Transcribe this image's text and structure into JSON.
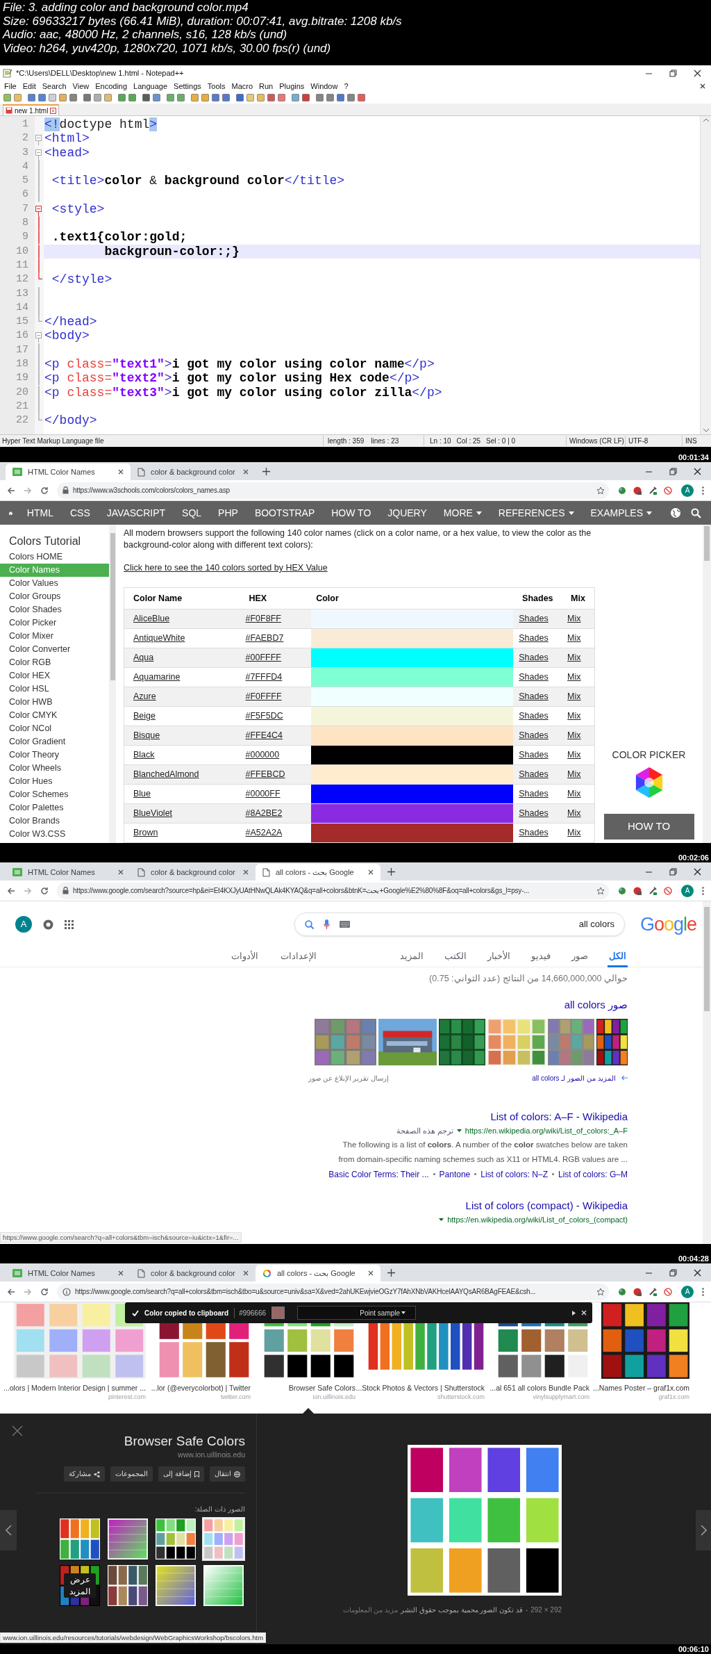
{
  "video_info": [
    "File: 3. adding color and background color.mp4",
    "Size: 69633217 bytes (66.41 MiB), duration: 00:07:41, avg.bitrate: 1208 kb/s",
    "Audio: aac, 48000 Hz, 2 channels, s16, 128 kb/s (und)",
    "Video: h264, yuv420p, 1280x720, 1071 kb/s, 30.00 fps(r) (und)"
  ],
  "frames": [
    {
      "kind": "notepad",
      "timestamp": "00:01:34",
      "title": "*C:\\Users\\DELL\\Desktop\\new 1.html - Notepad++",
      "menu": [
        "File",
        "Edit",
        "Search",
        "View",
        "Encoding",
        "Language",
        "Settings",
        "Tools",
        "Macro",
        "Run",
        "Plugins",
        "Window",
        "?"
      ],
      "file_tab": "new 1.html",
      "lines": [
        {
          "number": "1",
          "current": false,
          "tokens": [
            {
              "kind": "match",
              "text": "<!"
            },
            {
              "kind": "plain",
              "text": "doctype html"
            },
            {
              "kind": "match",
              "text": ">"
            }
          ]
        },
        {
          "number": "2",
          "current": false,
          "kind": "fold-start",
          "active": false,
          "tokens": [
            {
              "kind": "tag",
              "text": "<html>"
            }
          ]
        },
        {
          "number": "3",
          "current": false,
          "kind": "fold-start",
          "active": false,
          "tokens": [
            {
              "kind": "tag",
              "text": "<head>"
            }
          ]
        },
        {
          "number": "4",
          "current": false,
          "kind": "fold-line",
          "active": false
        },
        {
          "number": "5",
          "current": false,
          "kind": "fold-line",
          "active": false,
          "tokens": [
            {
              "kind": "tag",
              "text": " <title>"
            },
            {
              "kind": "text",
              "text": "color "
            },
            {
              "kind": "plain",
              "text": "&"
            },
            {
              "kind": "text",
              "text": " background color"
            },
            {
              "kind": "tag",
              "text": "</title>"
            }
          ]
        },
        {
          "number": "6",
          "current": false,
          "kind": "fold-line",
          "active": false
        },
        {
          "number": "7",
          "current": false,
          "kind": "fold-start",
          "active": true,
          "tokens": [
            {
              "kind": "tag",
              "text": " <style>"
            }
          ]
        },
        {
          "number": "8",
          "current": false,
          "kind": "fold-line",
          "active": true
        },
        {
          "number": "9",
          "current": false,
          "kind": "fold-line",
          "active": true,
          "tokens": [
            {
              "kind": "text",
              "text": " .text1{color:gold;"
            }
          ]
        },
        {
          "number": "10",
          "current": true,
          "kind": "fold-line",
          "active": true,
          "tokens": [
            {
              "kind": "text",
              "text": "        backgroun-color:;}"
            }
          ]
        },
        {
          "number": "11",
          "current": false,
          "kind": "fold-line",
          "active": true
        },
        {
          "number": "12",
          "current": false,
          "kind": "fold-end",
          "active": true,
          "tokens": [
            {
              "kind": "tag",
              "text": " </style>"
            }
          ]
        },
        {
          "number": "13",
          "current": false,
          "kind": "fold-line",
          "active": false
        },
        {
          "number": "14",
          "current": false,
          "kind": "fold-line",
          "active": false
        },
        {
          "number": "15",
          "current": false,
          "kind": "fold-end",
          "active": false,
          "tokens": [
            {
              "kind": "tag",
              "text": "</head>"
            }
          ]
        },
        {
          "number": "16",
          "current": false,
          "kind": "fold-start",
          "active": false,
          "tokens": [
            {
              "kind": "tag",
              "text": "<body>"
            }
          ]
        },
        {
          "number": "17",
          "current": false,
          "kind": "fold-line",
          "active": false
        },
        {
          "number": "18",
          "current": false,
          "kind": "fold-line",
          "active": false,
          "tokens": [
            {
              "kind": "tag",
              "text": "<p "
            },
            {
              "kind": "attr",
              "text": "class="
            },
            {
              "kind": "value",
              "text": "\"text1\""
            },
            {
              "kind": "tag",
              "text": ">"
            },
            {
              "kind": "text",
              "text": "i got my color using color name"
            },
            {
              "kind": "tag",
              "text": "</p>"
            }
          ]
        },
        {
          "number": "19",
          "current": false,
          "kind": "fold-line",
          "active": false,
          "tokens": [
            {
              "kind": "tag",
              "text": "<p "
            },
            {
              "kind": "attr",
              "text": "class="
            },
            {
              "kind": "value",
              "text": "\"text2\""
            },
            {
              "kind": "tag",
              "text": ">"
            },
            {
              "kind": "text",
              "text": "i got my color using Hex code"
            },
            {
              "kind": "tag",
              "text": "</p>"
            }
          ]
        },
        {
          "number": "20",
          "current": false,
          "kind": "fold-line",
          "active": false,
          "tokens": [
            {
              "kind": "tag",
              "text": "<p "
            },
            {
              "kind": "attr",
              "text": "class="
            },
            {
              "kind": "value",
              "text": "\"text3\""
            },
            {
              "kind": "tag",
              "text": ">"
            },
            {
              "kind": "text",
              "text": "i got my color using color zilla"
            },
            {
              "kind": "tag",
              "text": "</p>"
            }
          ]
        },
        {
          "number": "21",
          "current": false,
          "kind": "fold-line",
          "active": false
        },
        {
          "number": "22",
          "current": false,
          "kind": "fold-end",
          "active": false,
          "tokens": [
            {
              "kind": "tag",
              "text": "</body>"
            }
          ]
        }
      ],
      "status": {
        "file_type": "Hyper Text Markup Language file",
        "length": "length : 359",
        "line_count": "lines : 23",
        "ln": "Ln : 10",
        "col": "Col : 25",
        "sel": "Sel : 0 | 0",
        "eol": "Windows (CR LF)",
        "encoding": "UTF-8",
        "mode": "INS"
      }
    },
    {
      "kind": "w3schools",
      "timestamp": "00:02:06",
      "browser": {
        "tabs": [
          {
            "title": "HTML Color Names",
            "kind": "site",
            "selected": true
          },
          {
            "title": "color & background color",
            "kind": "page",
            "selected": false
          }
        ],
        "url": "https://www.w3schools.com/colors/colors_names.asp",
        "secure": true,
        "profile": "A"
      },
      "nav_left": [
        {
          "label": "HTML",
          "menu": false
        },
        {
          "label": "CSS",
          "menu": false
        },
        {
          "label": "JAVASCRIPT",
          "menu": false
        },
        {
          "label": "SQL",
          "menu": false
        },
        {
          "label": "PHP",
          "menu": false
        },
        {
          "label": "BOOTSTRAP",
          "menu": false
        },
        {
          "label": "HOW TO",
          "menu": false
        },
        {
          "label": "JQUERY",
          "menu": false
        },
        {
          "label": "MORE",
          "menu": true
        }
      ],
      "nav_right": [
        {
          "label": "REFERENCES",
          "menu": true
        },
        {
          "label": "EXAMPLES",
          "menu": true
        }
      ],
      "sidebar": {
        "title": "Colors Tutorial",
        "items": [
          {
            "label": "Colors HOME",
            "selected": false
          },
          {
            "label": "Color Names",
            "selected": true
          },
          {
            "label": "Color Values",
            "selected": false
          },
          {
            "label": "Color Groups",
            "selected": false
          },
          {
            "label": "Color Shades",
            "selected": false
          },
          {
            "label": "Color Picker",
            "selected": false
          },
          {
            "label": "Color Mixer",
            "selected": false
          },
          {
            "label": "Color Converter",
            "selected": false
          },
          {
            "label": "Color RGB",
            "selected": false
          },
          {
            "label": "Color HEX",
            "selected": false
          },
          {
            "label": "Color HSL",
            "selected": false
          },
          {
            "label": "Color HWB",
            "selected": false
          },
          {
            "label": "Color CMYK",
            "selected": false
          },
          {
            "label": "Color NCol",
            "selected": false
          },
          {
            "label": "Color Gradient",
            "selected": false
          },
          {
            "label": "Color Theory",
            "selected": false
          },
          {
            "label": "Color Wheels",
            "selected": false
          },
          {
            "label": "Color Hues",
            "selected": false
          },
          {
            "label": "Color Schemes",
            "selected": false
          },
          {
            "label": "Color Palettes",
            "selected": false
          },
          {
            "label": "Color Brands",
            "selected": false
          },
          {
            "label": "Color W3.CSS",
            "selected": false
          }
        ]
      },
      "intro": "All modern browsers support the following 140 color names (click on a color name, or a hex value, to view the color as the background-color along with different text colors):",
      "sort_link": "Click here to see the 140 colors sorted by HEX Value",
      "table": {
        "columns": [
          "Color Name",
          "HEX",
          "Color",
          "Shades",
          "Mix"
        ],
        "rows": [
          {
            "name": "AliceBlue",
            "hex": "#F0F8FF",
            "color": "#f0f8ff",
            "shades": "Shades",
            "mix": "Mix"
          },
          {
            "name": "AntiqueWhite",
            "hex": "#FAEBD7",
            "color": "#faebd7",
            "shades": "Shades",
            "mix": "Mix"
          },
          {
            "name": "Aqua",
            "hex": "#00FFFF",
            "color": "#00ffff",
            "shades": "Shades",
            "mix": "Mix"
          },
          {
            "name": "Aquamarine",
            "hex": "#7FFFD4",
            "color": "#7fffd4",
            "shades": "Shades",
            "mix": "Mix"
          },
          {
            "name": "Azure",
            "hex": "#F0FFFF",
            "color": "#f0ffff",
            "shades": "Shades",
            "mix": "Mix"
          },
          {
            "name": "Beige",
            "hex": "#F5F5DC",
            "color": "#f5f5dc",
            "shades": "Shades",
            "mix": "Mix"
          },
          {
            "name": "Bisque",
            "hex": "#FFE4C4",
            "color": "#ffe4c4",
            "shades": "Shades",
            "mix": "Mix"
          },
          {
            "name": "Black",
            "hex": "#000000",
            "color": "#000000",
            "shades": "Shades",
            "mix": "Mix"
          },
          {
            "name": "BlanchedAlmond",
            "hex": "#FFEBCD",
            "color": "#ffebcd",
            "shades": "Shades",
            "mix": "Mix"
          },
          {
            "name": "Blue",
            "hex": "#0000FF",
            "color": "#0000ff",
            "shades": "Shades",
            "mix": "Mix"
          },
          {
            "name": "BlueViolet",
            "hex": "#8A2BE2",
            "color": "#8a2be2",
            "shades": "Shades",
            "mix": "Mix"
          },
          {
            "name": "Brown",
            "hex": "#A52A2A",
            "color": "#a52a2a",
            "shades": "Shades",
            "mix": "Mix"
          }
        ]
      },
      "aside": {
        "title": "COLOR PICKER",
        "button": "HOW TO"
      }
    },
    {
      "kind": "google_search",
      "timestamp": "00:04:28",
      "browser": {
        "tabs": [
          {
            "title": "HTML Color Names",
            "kind": "site",
            "selected": false
          },
          {
            "title": "color & background color",
            "kind": "page",
            "selected": false
          },
          {
            "title": "all colors - بحث Google",
            "kind": "page",
            "selected": true
          }
        ],
        "url": "https://www.google.com/search?source=hp&ei=Et4KXJyUAtHNwQLAk4KYAQ&q=all+colors&btnK=بحث+Google%E2%80%8F&oq=all+colors&gs_l=psy-...",
        "secure": true,
        "profile": "A"
      },
      "account": "A",
      "query": "all colors",
      "logo": "Google",
      "tabs": [
        {
          "label": "الكل",
          "selected": true
        },
        {
          "label": "صور",
          "selected": false
        },
        {
          "label": "فيديو",
          "selected": false
        },
        {
          "label": "الأخبار",
          "selected": false
        },
        {
          "label": "الكتب",
          "selected": false
        },
        {
          "label": "المزيد",
          "selected": false
        }
      ],
      "tools": [
        "الإعدادات",
        "الأدوات"
      ],
      "stats": "حوالي 14,660,000,000 من النتائج (عدد الثواني: 0.75)",
      "images_heading": "صور all colors",
      "images": [
        {
          "kind": "picture"
        },
        {
          "kind": "picture"
        },
        {
          "kind": "picture"
        },
        {
          "kind": "picture"
        },
        {
          "kind": "picture"
        },
        {
          "kind": "picture"
        }
      ],
      "more_images": "المزيد من الصور لـ all colors",
      "report": "إرسال تقرير الإبلاغ عن صور",
      "results": [
        {
          "title": "List of colors: A–F - Wikipedia",
          "url": "https://en.wikipedia.org/wiki/List_of_colors:_A–F",
          "translate": "ترجم هذه الصفحة",
          "snippet": "The following is a list of **colors**. A number of the **color** swatches below are taken from domain-specific naming schemes such as X11 or HTML4. RGB values are ...",
          "sitelinks": [
            "Basic Color Terms: Their ...",
            "Pantone",
            "List of colors: N–Z",
            "List of colors: G–M"
          ]
        },
        {
          "title": "List of colors (compact) - Wikipedia",
          "url": "https://en.wikipedia.org/wiki/List_of_colors_(compact)"
        }
      ],
      "status_url": "https://www.google.com/search?q=all+colors&tbm=isch&source=iu&ictx=1&fir=..."
    },
    {
      "kind": "google_images",
      "timestamp": "00:06:10",
      "browser": {
        "tabs": [
          {
            "title": "HTML Color Names",
            "kind": "site",
            "selected": false
          },
          {
            "title": "color & background color",
            "kind": "page",
            "selected": false
          },
          {
            "title": "all colors - بحث Google",
            "kind": "search",
            "selected": true
          }
        ],
        "url": "https://www.google.com/search?q=all+colors&tbm=isch&tbo=u&source=univ&sa=X&ved=2ahUKEwjvieOGzY7fAhXNbVAKHcelAAYQsAR6BAgFEAE&csh...",
        "secure": false,
        "profile": "A"
      },
      "results": [
        {
          "caption": "...olors | Modern Interior Design | summer ...",
          "source": "pinterest.com"
        },
        {
          "caption": "...lor (@everycolorbot) | Twitter",
          "source": "twitter.com"
        },
        {
          "caption": "Browser Safe Colors",
          "source": "ion.uillinois.edu"
        },
        {
          "caption": "...Stock Photos & Vectors | Shutterstock",
          "source": "shutterstock.com"
        },
        {
          "caption": "...al 651 all colors Bundle Pack",
          "source": "vinylsupplymart.com"
        },
        {
          "caption": "...Names Poster – graf1x.com",
          "source": "graf1x.com"
        }
      ],
      "picker": {
        "message": "Color copied to clipboard",
        "value": "#996666",
        "mode": "Point sample"
      },
      "viewer": {
        "title": "Browser Safe Colors",
        "source": "www.ion.uillinois.edu",
        "actions": [
          {
            "label": "انتقال",
            "kind": "visit"
          },
          {
            "label": "إضافة إلى",
            "kind": "save"
          },
          {
            "label": "المجموعات"
          },
          {
            "label": "مشاركة",
            "kind": "share"
          }
        ],
        "related_label": "الصور ذات الصلة:",
        "related": [
          {
            "kind": "picture",
            "selected": false
          },
          {
            "kind": "picture",
            "selected": false
          },
          {
            "kind": "picture",
            "selected": false
          },
          {
            "kind": "picture",
            "selected": true
          },
          {
            "kind": "more",
            "label": "عرض المزيد",
            "selected": false
          },
          {
            "kind": "picture",
            "selected": false
          },
          {
            "kind": "picture",
            "selected": false
          },
          {
            "kind": "picture",
            "selected": false
          }
        ],
        "size": "292 × 292",
        "separator": "-",
        "notice": "قد تكون الصور محمية بموجب حقوق النشر",
        "more_info": "مزيد من المعلومات"
      },
      "status_url": "www.ion.uillinois.edu/resources/tutorials/webdesign/WebGraphicsWorkshop/bscolors.htm"
    }
  ]
}
